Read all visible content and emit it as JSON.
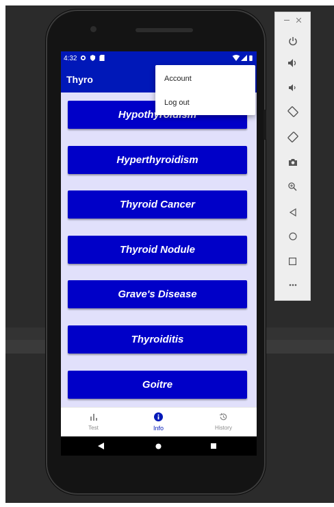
{
  "status_bar": {
    "time": "4:32"
  },
  "app_bar": {
    "title": "Thyro"
  },
  "overflow_menu": {
    "items": [
      "Account",
      "Log out"
    ]
  },
  "topics": [
    "Hypothyroidism",
    "Hyperthyroidism",
    "Thyroid Cancer",
    "Thyroid Nodule",
    "Grave's Disease",
    "Thyroiditis",
    "Goitre"
  ],
  "bottom_nav": {
    "items": [
      {
        "label": "Test",
        "icon": "bar-chart-icon"
      },
      {
        "label": "Info",
        "icon": "info-icon"
      },
      {
        "label": "History",
        "icon": "history-icon"
      }
    ],
    "selected": "Info"
  },
  "emulator_toolbar": {
    "window_controls": [
      "minimize-icon",
      "close-icon"
    ],
    "tools": [
      "power-icon",
      "volume-up-icon",
      "volume-down-icon",
      "rotate-left-icon",
      "rotate-right-icon",
      "camera-icon",
      "zoom-icon",
      "back-icon",
      "home-icon",
      "overview-icon",
      "more-icon"
    ]
  },
  "colors": {
    "primary": "#0018b8",
    "button": "#0000c8",
    "background": "#e1e0fb"
  }
}
